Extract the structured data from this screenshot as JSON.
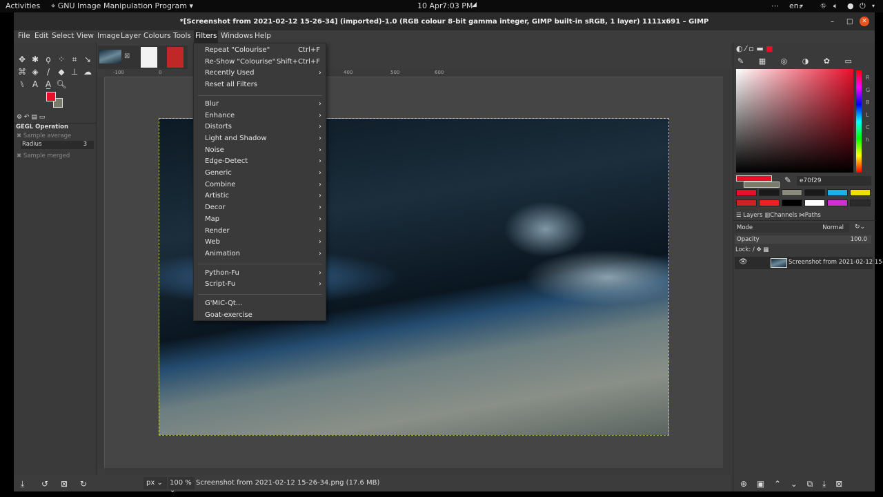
{
  "topbar": {
    "activities": "Activities",
    "app": "GNU Image Manipulation Program",
    "date": "10 Apr",
    "time": "7:03 PM",
    "lang": "en₁"
  },
  "window": {
    "title": "*[Screenshot from 2021-02-12 15-26-34] (imported)-1.0 (RGB colour 8-bit gamma integer, GIMP built-in sRGB, 1 layer) 1111x691 – GIMP"
  },
  "menubar": [
    "File",
    "Edit",
    "Select",
    "View",
    "Image",
    "Layer",
    "Colours",
    "Tools",
    "Filters",
    "Windows",
    "Help"
  ],
  "filters_menu": {
    "top": [
      {
        "label": "Repeat \"Colourise\"",
        "shortcut": "Ctrl+F"
      },
      {
        "label": "Re-Show \"Colourise\"",
        "shortcut": "Shift+Ctrl+F"
      },
      {
        "label": "Recently Used",
        "submenu": true
      },
      {
        "label": "Reset all Filters"
      }
    ],
    "categories": [
      "Blur",
      "Enhance",
      "Distorts",
      "Light and Shadow",
      "Noise",
      "Edge-Detect",
      "Generic",
      "Combine",
      "Artistic",
      "Decor",
      "Map",
      "Render",
      "Web",
      "Animation"
    ],
    "scripts": [
      "Python-Fu",
      "Script-Fu"
    ],
    "plugins": [
      "G'MIC-Qt...",
      "Goat-exercise"
    ]
  },
  "tool_options": {
    "title": "GEGL Operation",
    "sample_average": "Sample average",
    "radius_label": "Radius",
    "radius_value": "3",
    "sample_merged": "Sample merged"
  },
  "ruler": {
    "h_ticks": [
      "-100",
      "0",
      "400",
      "500",
      "600"
    ]
  },
  "colors": {
    "fg": "#e70f29",
    "bg": "#7a7a6a",
    "hex": "e70f29",
    "history": [
      "#e70f29",
      "#1a1a1a",
      "#8a8a7a",
      "#1a1a1a",
      "#1ab0e8",
      "#f0e000",
      "#d02020",
      "#f02020",
      "#000000",
      "#ffffff",
      "#d030d0",
      "#2a2a2a"
    ],
    "channels": [
      "R",
      "G",
      "B",
      "L",
      "C",
      "h"
    ]
  },
  "layers": {
    "tabs": [
      "Layers",
      "Channels",
      "Paths"
    ],
    "mode_label": "Mode",
    "mode_value": "Normal",
    "opacity_label": "Opacity",
    "opacity_value": "100.0",
    "lock_label": "Lock:",
    "layer_name": "Screenshot from 2021-02-12 15-"
  },
  "status": {
    "unit": "px",
    "zoom": "100 %",
    "file": "Screenshot from 2021-02-12 15-26-34.png (17.6 MB)"
  }
}
